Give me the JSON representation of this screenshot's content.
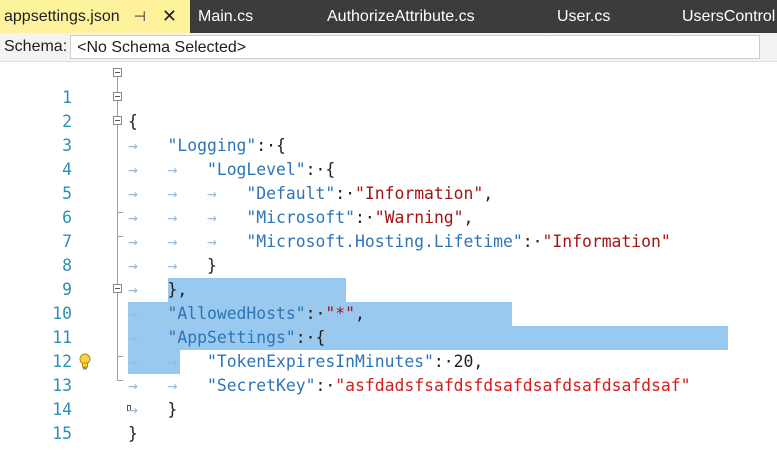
{
  "tabs": [
    {
      "label": "appsettings.json",
      "pin": "⊣",
      "close": "✕",
      "active": true
    },
    {
      "label": "Main.cs"
    },
    {
      "label": "AuthorizeAttribute.cs"
    },
    {
      "label": "User.cs"
    },
    {
      "label": "UsersControl"
    }
  ],
  "schema": {
    "label": "Schema:",
    "value": "<No Schema Selected>"
  },
  "lines": [
    {
      "n": "1"
    },
    {
      "n": "2"
    },
    {
      "n": "3"
    },
    {
      "n": "4"
    },
    {
      "n": "5"
    },
    {
      "n": "6"
    },
    {
      "n": "7"
    },
    {
      "n": "8"
    },
    {
      "n": "9"
    },
    {
      "n": "10"
    },
    {
      "n": "11"
    },
    {
      "n": "12"
    },
    {
      "n": "13"
    },
    {
      "n": "14"
    },
    {
      "n": "15"
    }
  ],
  "code": {
    "l1_open": "{",
    "logging_key": "\"Logging\"",
    "loglevel_key": "\"LogLevel\"",
    "default_key": "\"Default\"",
    "default_val": "\"Information\"",
    "microsoft_key": "\"Microsoft\"",
    "microsoft_val": "\"Warning\"",
    "hosting_key": "\"Microsoft.Hosting.Lifetime\"",
    "hosting_val": "\"Information\"",
    "allowedhosts_key": "\"AllowedHosts\"",
    "allowedhosts_val": "\"*\"",
    "appsettings_key": "\"AppSettings\"",
    "token_key": "\"TokenExpiresInMinutes\"",
    "token_val": "20",
    "secret_key": "\"SecretKey\"",
    "secret_val": "\"asfdadsfsafdsfdsafdsafdsafdsafdsaf\""
  },
  "colors": {
    "key": "#2e75b6",
    "string": "#a31515",
    "selection": "#99c9ef",
    "line_number": "#2b91af",
    "active_tab": "#fff29d"
  },
  "icons": [
    "pin-icon",
    "close-icon",
    "lightbulb-icon",
    "fold-toggle-icon"
  ]
}
